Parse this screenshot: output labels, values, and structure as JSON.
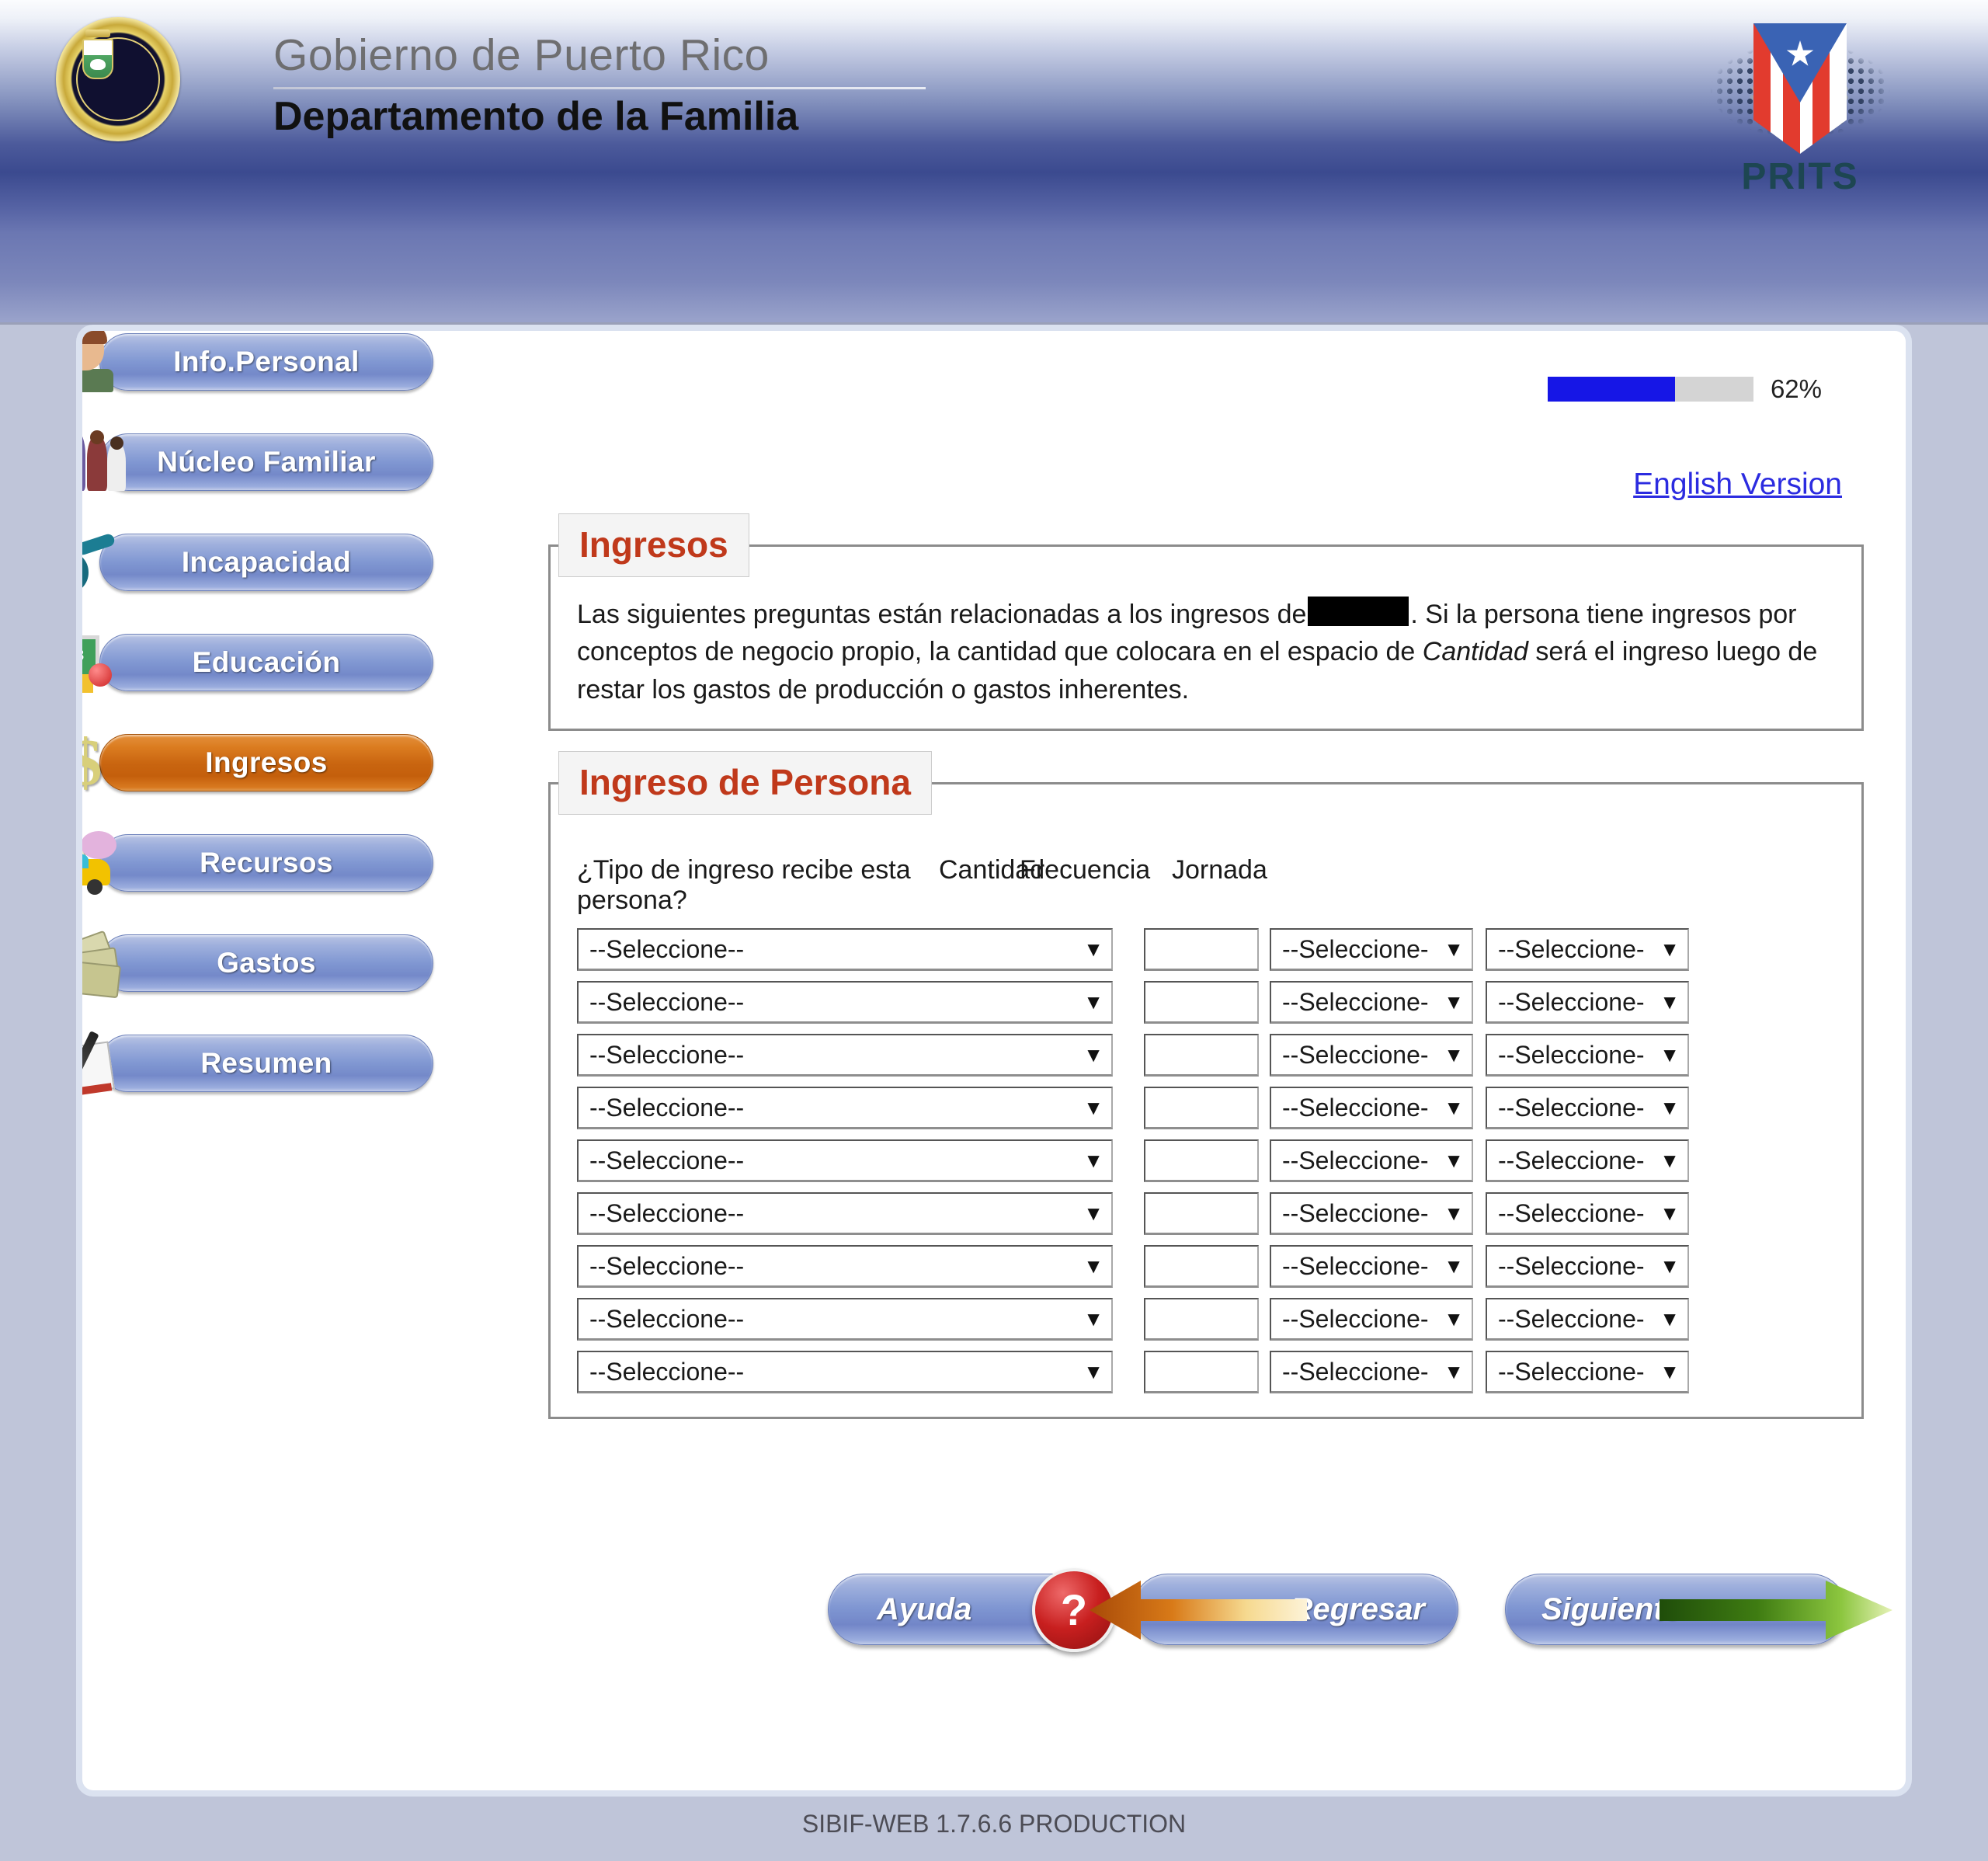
{
  "header": {
    "government_line": "Gobierno de Puerto Rico",
    "department_line": "Departamento de la Familia",
    "seal_alt": "puerto-rico-seal",
    "logo_word": "PRITS"
  },
  "progress": {
    "percent_label": "62%",
    "percent_value": 62,
    "fill_color": "#1616e6",
    "track_color": "#d4d4d4"
  },
  "language_link": {
    "label": "English Version"
  },
  "sidebar": {
    "items": [
      {
        "label": "Info.Personal",
        "icon": "person-icon",
        "active": false
      },
      {
        "label": "Núcleo Familiar",
        "icon": "family-icon",
        "active": false
      },
      {
        "label": "Incapacidad",
        "icon": "wheelchair-icon",
        "active": false
      },
      {
        "label": "Educación",
        "icon": "chalkboard-icon",
        "active": false
      },
      {
        "label": "Ingresos",
        "icon": "dollar-sign-icon",
        "active": true
      },
      {
        "label": "Recursos",
        "icon": "car-piggybank-icon",
        "active": false
      },
      {
        "label": "Gastos",
        "icon": "money-bills-icon",
        "active": false
      },
      {
        "label": "Resumen",
        "icon": "notepad-pen-icon",
        "active": false
      }
    ],
    "active_color": "#c96510",
    "inactive_color": "#8097d2"
  },
  "intro_section": {
    "legend": "Ingresos",
    "text_before_redaction": "Las siguientes preguntas están relacionadas a los ingresos de",
    "redaction": "",
    "text_after_redaction": ". Si la persona tiene ingresos por conceptos de negocio propio, la cantidad que colocara en el espacio de",
    "emphasis_word": "Cantidad",
    "text_end": "será el ingreso luego de restar los gastos de producción o gastos inherentes.",
    "legend_color": "#c0391b"
  },
  "income_section": {
    "legend": "Ingreso de Persona",
    "columns": {
      "tipo": "¿Tipo de ingreso recibe esta persona?",
      "cantidad": "Cantidad",
      "frecuencia": "Frecuencia",
      "jornada": "Jornada"
    },
    "placeholder_wide": "--Seleccione--",
    "placeholder_narrow": "--Seleccione-",
    "rows": [
      {
        "tipo": "--Seleccione--",
        "cantidad": "",
        "frecuencia": "--Seleccione-",
        "jornada": "--Seleccione-"
      },
      {
        "tipo": "--Seleccione--",
        "cantidad": "",
        "frecuencia": "--Seleccione-",
        "jornada": "--Seleccione-"
      },
      {
        "tipo": "--Seleccione--",
        "cantidad": "",
        "frecuencia": "--Seleccione-",
        "jornada": "--Seleccione-"
      },
      {
        "tipo": "--Seleccione--",
        "cantidad": "",
        "frecuencia": "--Seleccione-",
        "jornada": "--Seleccione-"
      },
      {
        "tipo": "--Seleccione--",
        "cantidad": "",
        "frecuencia": "--Seleccione-",
        "jornada": "--Seleccione-"
      },
      {
        "tipo": "--Seleccione--",
        "cantidad": "",
        "frecuencia": "--Seleccione-",
        "jornada": "--Seleccione-"
      },
      {
        "tipo": "--Seleccione--",
        "cantidad": "",
        "frecuencia": "--Seleccione-",
        "jornada": "--Seleccione-"
      },
      {
        "tipo": "--Seleccione--",
        "cantidad": "",
        "frecuencia": "--Seleccione-",
        "jornada": "--Seleccione-"
      },
      {
        "tipo": "--Seleccione--",
        "cantidad": "",
        "frecuencia": "--Seleccione-",
        "jornada": "--Seleccione-"
      }
    ]
  },
  "buttons": {
    "ayuda": "Ayuda",
    "ayuda_icon": "question-mark-icon",
    "regresar": "Regresar",
    "regresar_icon": "arrow-left-icon",
    "siguiente": "Siguiente",
    "siguiente_icon": "arrow-right-icon"
  },
  "footer": {
    "version_text": "SIBIF-WEB 1.7.6.6 PRODUCTION"
  }
}
